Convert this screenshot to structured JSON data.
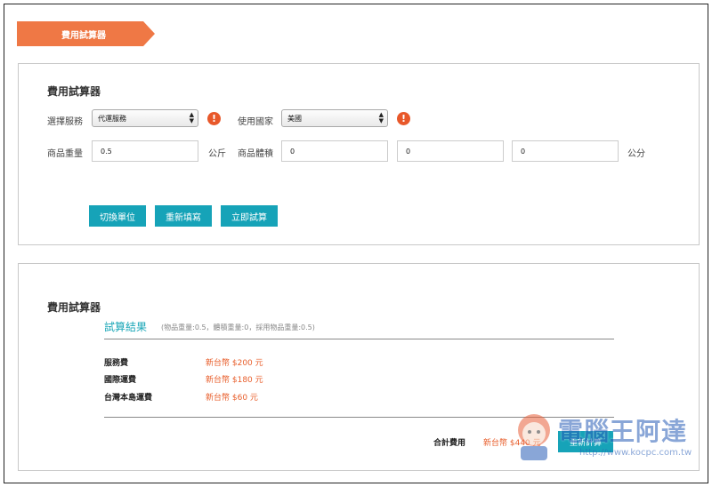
{
  "header": {
    "ribbon_label": "費用試算器"
  },
  "calculator": {
    "title": "費用試算器",
    "service_label": "選擇服務",
    "service_value": "代運服務",
    "country_label": "使用國家",
    "country_value": "美國",
    "weight_label": "商品重量",
    "weight_value": "0.5",
    "weight_unit": "公斤",
    "volume_label": "商品體積",
    "volume_values": [
      "0",
      "0",
      "0"
    ],
    "volume_unit": "公分",
    "buttons": {
      "switch_unit": "切換單位",
      "reset": "重新填寫",
      "calculate": "立即試算"
    }
  },
  "result": {
    "panel_title": "費用試算器",
    "title": "試算結果",
    "note": "(物品重量:0.5，體積重量:0，採用物品重量:0.5)",
    "rows": [
      {
        "label": "服務費",
        "value": "新台幣 $200 元"
      },
      {
        "label": "國際運費",
        "value": "新台幣 $180 元"
      },
      {
        "label": "台灣本島運費",
        "value": "新台幣 $60 元"
      }
    ],
    "total_label": "合計費用",
    "total_value": "新台幣 $440 元",
    "recalc_label": "重新計算"
  },
  "watermark": {
    "text": "電腦王阿達",
    "url": "http://www.kocpc.com.tw"
  },
  "colors": {
    "accent": "#16a3b8",
    "ribbon": "#ef7845",
    "price": "#e85d2a",
    "warning": "#e8582a"
  }
}
